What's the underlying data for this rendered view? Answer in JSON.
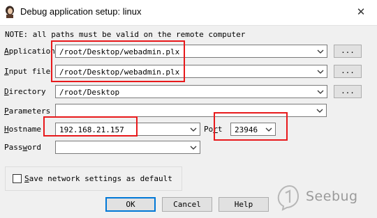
{
  "window": {
    "title": "Debug application setup: linux",
    "close_glyph": "✕"
  },
  "note": "NOTE: all paths must be valid on the remote computer",
  "fields": {
    "application": {
      "label_prefix": "",
      "label_mnemonic": "A",
      "label_rest": "pplication",
      "value": "/root/Desktop/webadmin.plx",
      "browse": "..."
    },
    "input_file": {
      "label_prefix": "",
      "label_mnemonic": "I",
      "label_rest": "nput file",
      "value": "/root/Desktop/webadmin.plx",
      "browse": "..."
    },
    "directory": {
      "label_prefix": "",
      "label_mnemonic": "D",
      "label_rest": "irectory",
      "value": "/root/Desktop",
      "browse": "..."
    },
    "parameters": {
      "label_prefix": "",
      "label_mnemonic": "P",
      "label_rest": "arameters",
      "value": ""
    },
    "hostname": {
      "label_prefix": "",
      "label_mnemonic": "H",
      "label_rest": "ostname",
      "value": "192.168.21.157"
    },
    "port": {
      "label_prefix": "Po",
      "label_mnemonic": "r",
      "label_rest": "t",
      "value": "23946"
    },
    "password": {
      "label_prefix": "Pass",
      "label_mnemonic": "w",
      "label_rest": "ord",
      "value": ""
    }
  },
  "save_settings": {
    "label_prefix": "",
    "label_mnemonic": "S",
    "label_rest": "ave network settings as default",
    "checked": false
  },
  "buttons": {
    "ok": "OK",
    "cancel": "Cancel",
    "help": "Help"
  },
  "watermark": {
    "text": "Seebug"
  },
  "colors": {
    "highlight": "#e8191b",
    "default_button_border": "#0078d7"
  },
  "icons": {
    "app": "ida-portrait-icon",
    "dropdown": "chevron-down-icon"
  }
}
